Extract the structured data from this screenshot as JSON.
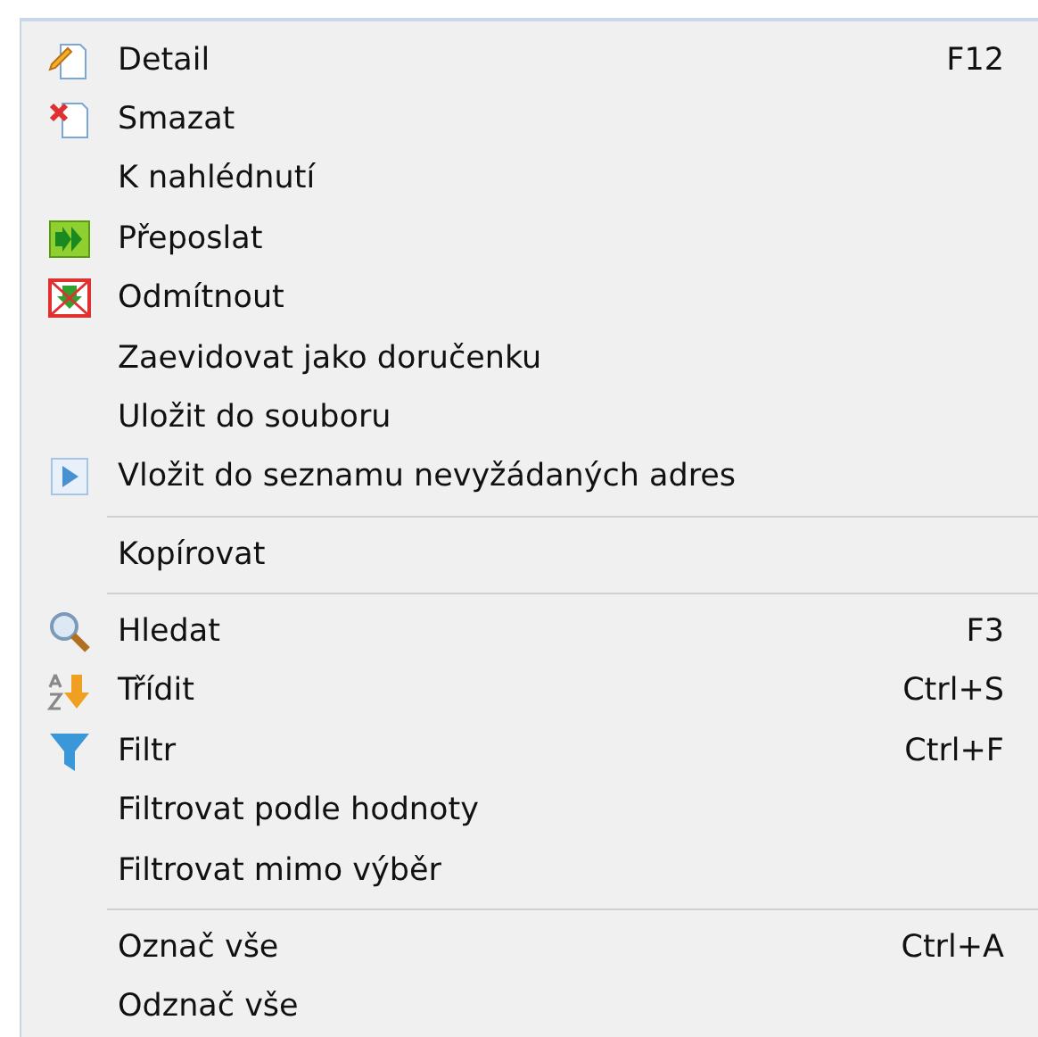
{
  "menu": [
    {
      "kind": "item",
      "label": "Detail",
      "shortcut": "F12"
    },
    {
      "kind": "item",
      "label": "Smazat"
    },
    {
      "kind": "item",
      "label": "K nahlédnutí"
    },
    {
      "kind": "item",
      "label": "Přeposlat"
    },
    {
      "kind": "item",
      "label": "Odmítnout"
    },
    {
      "kind": "item",
      "label": "Zaevidovat jako doručenku"
    },
    {
      "kind": "item",
      "label": "Uložit do souboru"
    },
    {
      "kind": "item",
      "label": "Vložit do seznamu nevyžádaných adres"
    },
    {
      "kind": "separator"
    },
    {
      "kind": "item",
      "label": "Kopírovat"
    },
    {
      "kind": "separator"
    },
    {
      "kind": "item",
      "label": "Hledat",
      "shortcut": "F3"
    },
    {
      "kind": "item",
      "label": "Třídit",
      "shortcut": "Ctrl+S"
    },
    {
      "kind": "item",
      "label": "Filtr",
      "shortcut": "Ctrl+F"
    },
    {
      "kind": "item",
      "label": "Filtrovat podle hodnoty"
    },
    {
      "kind": "item",
      "label": "Filtrovat mimo výběr"
    },
    {
      "kind": "separator"
    },
    {
      "kind": "item",
      "label": "Označ vše",
      "shortcut": "Ctrl+A"
    },
    {
      "kind": "item",
      "label": "Odznač vše"
    }
  ]
}
